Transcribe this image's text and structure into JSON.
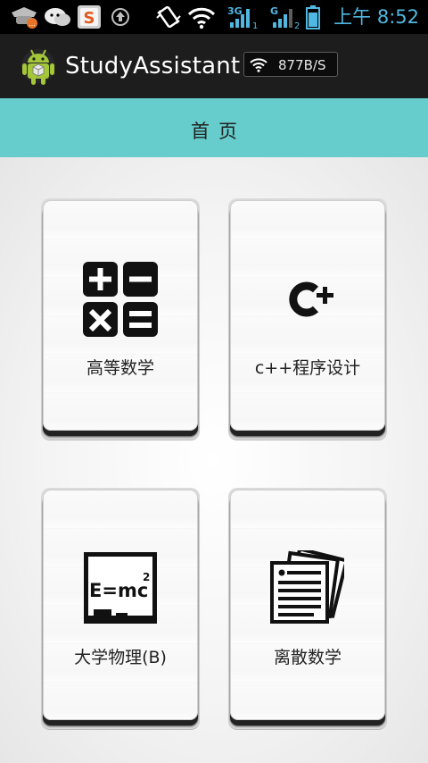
{
  "status_bar": {
    "time": "上午 8:52",
    "icons": [
      "hat-notification-icon",
      "chat-notification-icon",
      "sogou-input-icon",
      "upload-icon",
      "vibrate-icon",
      "wifi-icon",
      "signal-3g-1-icon",
      "signal-g-2-icon",
      "battery-icon"
    ]
  },
  "action_bar": {
    "app_title": "StudyAssistant",
    "app_icon": "android-icon",
    "net_speed": "877B/S",
    "net_icon": "wifi-icon"
  },
  "page_header": {
    "title": "首页"
  },
  "cards": [
    {
      "label": "高等数学",
      "icon": "calculator-icon"
    },
    {
      "label": "c++程序设计",
      "icon": "cplusplus-icon"
    },
    {
      "label": "大学物理(B)",
      "icon": "blackboard-emc2-icon"
    },
    {
      "label": "离散数学",
      "icon": "document-stack-icon"
    }
  ],
  "colors": {
    "status_bar": "#000000",
    "status_accent": "#4fb7e0",
    "action_bar": "#1d1d1d",
    "header": "#66cccc",
    "android_green": "#a4c639"
  }
}
